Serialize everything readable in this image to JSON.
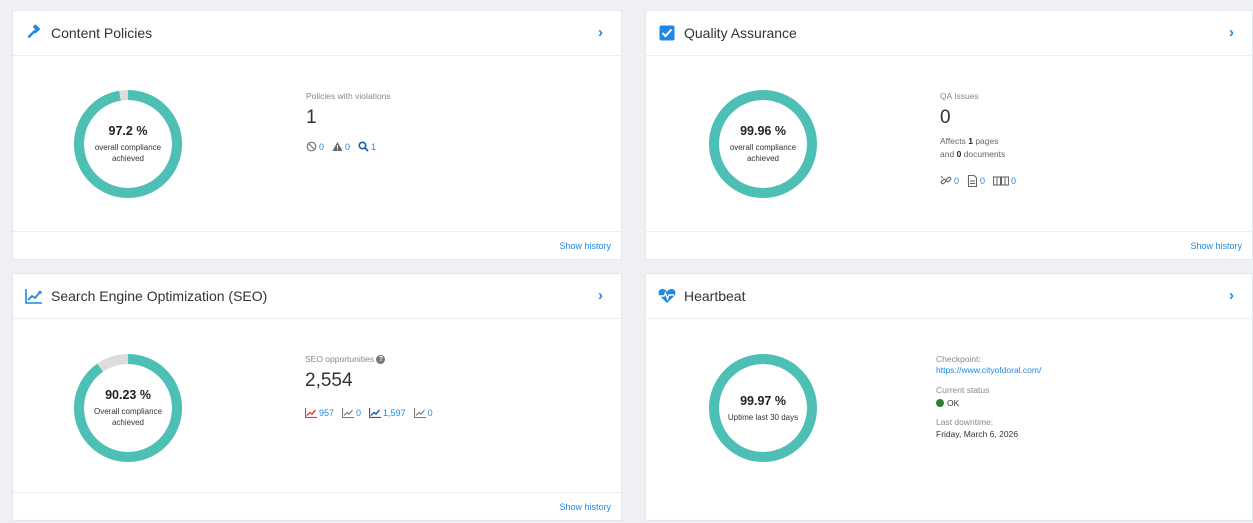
{
  "accent_color": "#4dbfb5",
  "link_color": "#1e88e5",
  "cards": {
    "content_policies": {
      "title": "Content Policies",
      "icon": "gavel-icon",
      "gauge": {
        "value": 97.2,
        "percent_label": "97.2 %",
        "subtitle": "overall compliance achieved"
      },
      "stat_label": "Policies with violations",
      "stat_value": "1",
      "icons": [
        {
          "name": "prohibited-icon",
          "count": "0"
        },
        {
          "name": "warning-icon",
          "count": "0"
        },
        {
          "name": "search-icon",
          "count": "1"
        }
      ],
      "show_history": "Show history"
    },
    "quality_assurance": {
      "title": "Quality Assurance",
      "icon": "checkbox-icon",
      "gauge": {
        "value": 99.96,
        "percent_label": "99.96 %",
        "subtitle": "overall compliance achieved"
      },
      "stat_label": "QA Issues",
      "stat_value": "0",
      "affects_prefix": "Affects",
      "affects_pages": "1",
      "affects_pages_suffix": "pages",
      "and_prefix": "and",
      "affects_documents": "0",
      "documents_suffix": "documents",
      "icons": [
        {
          "name": "broken-link-icon",
          "count": "0"
        },
        {
          "name": "document-icon",
          "count": "0"
        },
        {
          "name": "spelling-icon",
          "count": "0"
        }
      ],
      "show_history": "Show history"
    },
    "seo": {
      "title": "Search Engine Optimization (SEO)",
      "icon": "trend-chart-icon",
      "gauge": {
        "value": 90.23,
        "percent_label": "90.23 %",
        "subtitle": "Overall compliance achieved"
      },
      "stat_label": "SEO opportunities",
      "stat_value": "2,554",
      "icons": [
        {
          "name": "chart-red-icon",
          "count": "957"
        },
        {
          "name": "chart-gray-icon",
          "count": "0"
        },
        {
          "name": "chart-blue-icon",
          "count": "1,597"
        },
        {
          "name": "chart-gray-2-icon",
          "count": "0"
        }
      ],
      "show_history": "Show history"
    },
    "heartbeat": {
      "title": "Heartbeat",
      "icon": "heart-pulse-icon",
      "gauge": {
        "value": 99.97,
        "percent_label": "99.97 %",
        "subtitle": "Uptime last 30 days"
      },
      "checkpoint_label": "Checkpoint:",
      "checkpoint_url": "https://www.cityofdoral.com/",
      "status_label": "Current status",
      "status_value": "OK",
      "status_color": "#2e7d32",
      "downtime_label": "Last downtime:",
      "downtime_value": "Friday, March 6, 2026"
    }
  }
}
